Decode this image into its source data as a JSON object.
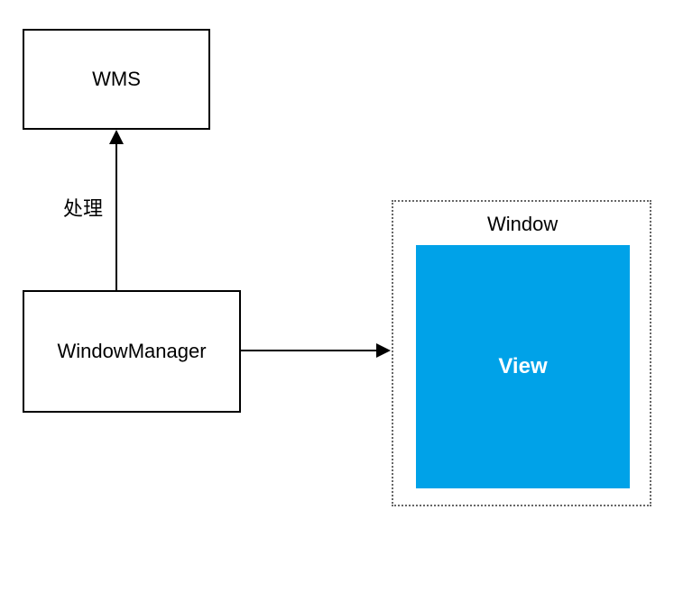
{
  "boxes": {
    "wms": {
      "label": "WMS"
    },
    "windowManager": {
      "label": "WindowManager"
    },
    "window": {
      "label": "Window"
    },
    "view": {
      "label": "View"
    }
  },
  "arrows": {
    "wmToWms": {
      "label": "处理"
    }
  },
  "colors": {
    "viewBackground": "#00a2e8",
    "viewText": "#ffffff",
    "border": "#000000"
  }
}
